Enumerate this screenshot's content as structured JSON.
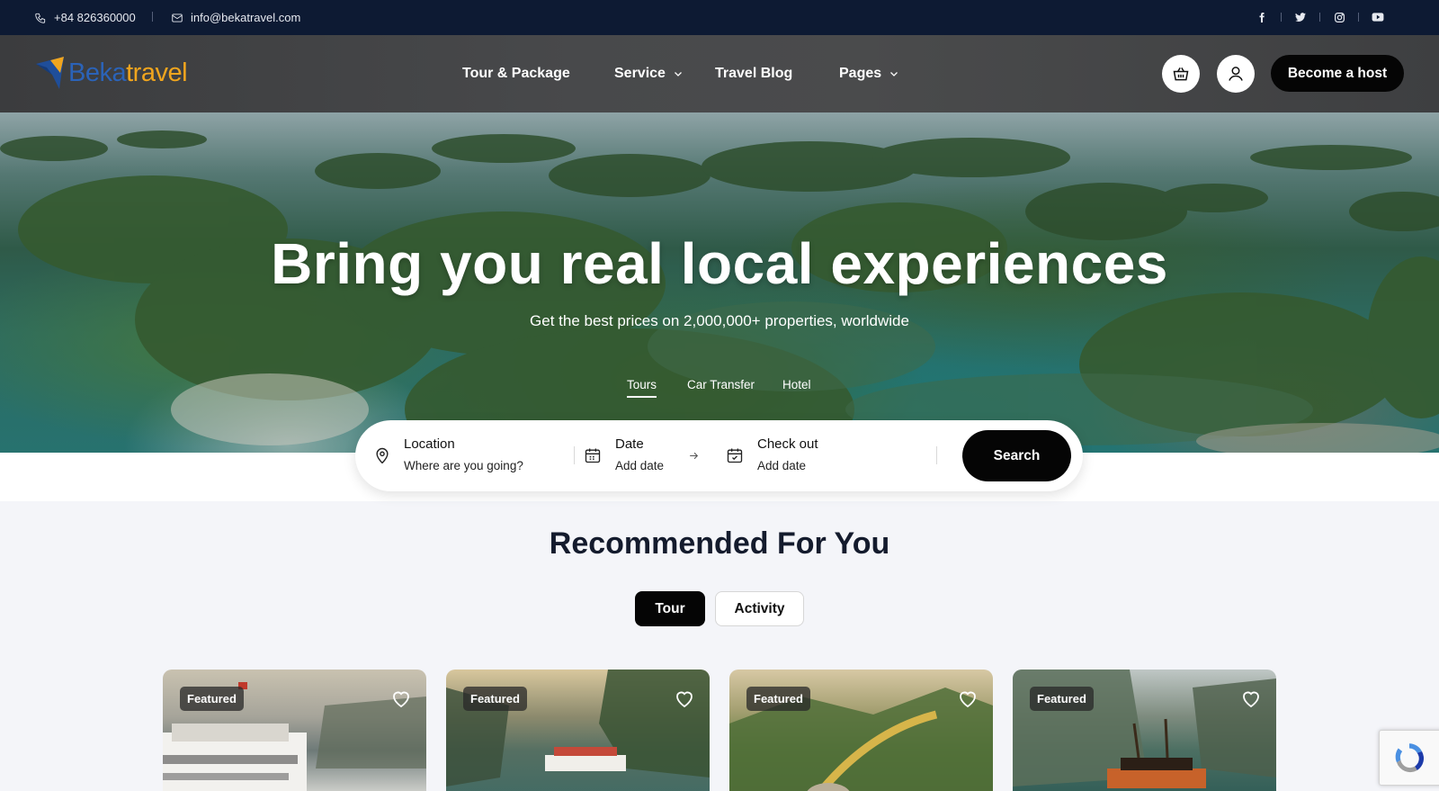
{
  "topbar": {
    "phone": "+84 826360000",
    "email": "info@bekatravel.com",
    "socials": [
      "facebook-icon",
      "twitter-icon",
      "instagram-icon",
      "youtube-icon"
    ]
  },
  "header": {
    "logo_part1": "Beka",
    "logo_part2": "travel",
    "nav": [
      {
        "label": "Tour & Package",
        "dropdown": false
      },
      {
        "label": "Service",
        "dropdown": true
      },
      {
        "label": "Travel Blog",
        "dropdown": false
      },
      {
        "label": "Pages",
        "dropdown": true
      }
    ],
    "become_host": "Become a host"
  },
  "hero": {
    "title": "Bring you real local experiences",
    "subtitle": "Get the best prices on 2,000,000+ properties, worldwide",
    "tabs": [
      "Tours",
      "Car Transfer",
      "Hotel"
    ],
    "active_tab": "Tours"
  },
  "search": {
    "location_label": "Location",
    "location_placeholder": "Where are you going?",
    "date_label": "Date",
    "date_value": "Add date",
    "checkout_label": "Check out",
    "checkout_value": "Add date",
    "button": "Search"
  },
  "recommended": {
    "title": "Recommended For You",
    "tabs": [
      "Tour",
      "Activity"
    ],
    "active_tab": "Tour",
    "cards": [
      {
        "badge": "Featured"
      },
      {
        "badge": "Featured"
      },
      {
        "badge": "Featured"
      },
      {
        "badge": "Featured"
      }
    ]
  },
  "colors": {
    "topbar_bg": "#0d1a33",
    "brand_blue": "#2b63b8",
    "brand_orange": "#f0a51e",
    "primary_button": "#050505"
  }
}
